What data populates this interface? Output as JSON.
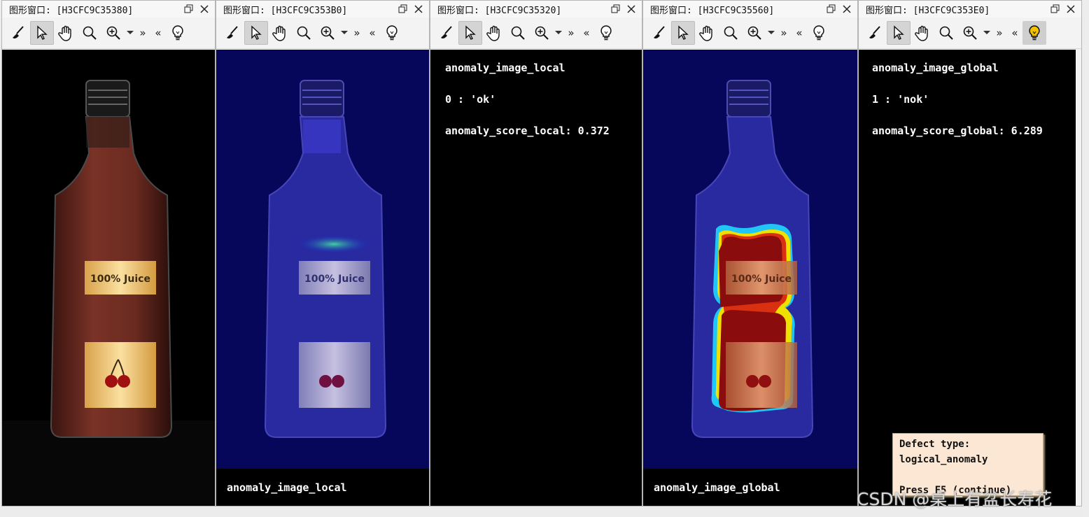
{
  "windows": [
    {
      "title": "图形窗口: [H3CFC9C35380]",
      "kind": "image",
      "overlay": "none",
      "bulb_on": false
    },
    {
      "title": "图形窗口: [H3CFC9C353B0]",
      "kind": "image",
      "overlay": "local",
      "caption": "anomaly_image_local",
      "bulb_on": false
    },
    {
      "title": "图形窗口: [H3CFC9C35320]",
      "kind": "text",
      "lines": [
        "anomaly_image_local",
        "0 : 'ok'",
        "anomaly_score_local: 0.372"
      ],
      "bulb_on": false
    },
    {
      "title": "图形窗口: [H3CFC9C35560]",
      "kind": "image",
      "overlay": "global",
      "caption": "anomaly_image_global",
      "bulb_on": false
    },
    {
      "title": "图形窗口: [H3CFC9C353E0]",
      "kind": "text",
      "lines": [
        "anomaly_image_global",
        "1 : 'nok'",
        "anomaly_score_global: 6.289"
      ],
      "bulb_on": true
    }
  ],
  "toolbar": {
    "icons": [
      "broom-icon",
      "pointer-icon",
      "hand-icon",
      "magnifier-icon",
      "zoom-in-icon",
      "dropdown-icon",
      "expand-icon",
      "collapse-icon",
      "lightbulb-icon"
    ],
    "expand_text": "»",
    "collapse_text": "«"
  },
  "image": {
    "label_top": "100% Juice"
  },
  "tooltip": {
    "line1": "Defect type:",
    "line2": "logical_anomaly",
    "line3": "Press F5 (continue)"
  },
  "watermark": "CSDN @桌上有盆长寿花",
  "colors": {
    "canvas_bg": "#000000",
    "bulb_on": "#f2c200",
    "juice": "#7a3226",
    "label": "#f1c56a"
  }
}
